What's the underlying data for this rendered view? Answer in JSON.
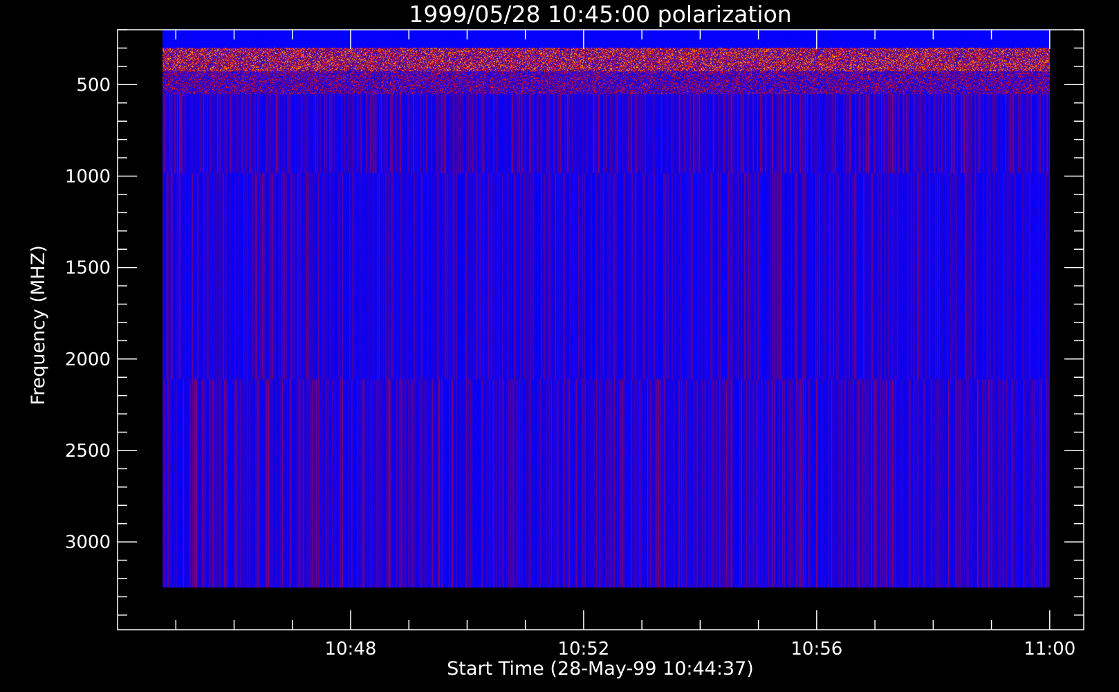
{
  "chart_data": {
    "type": "heatmap",
    "title": "1999/05/28 10:45:00 polarization",
    "xlabel": "Start Time (28-May-99 10:44:37)",
    "ylabel": "Frequency (MHZ)",
    "x_ticks": [
      "10:48",
      "10:52",
      "10:56",
      "11:00"
    ],
    "x_tick_minutes": [
      3.383,
      7.383,
      11.383,
      15.383
    ],
    "x_range_minutes": [
      -0.617,
      15.967
    ],
    "data_x_range_minutes": [
      0.15,
      15.383
    ],
    "y_ticks": [
      500,
      1000,
      1500,
      2000,
      2500,
      3000
    ],
    "y_range": [
      200,
      3480
    ],
    "y_reversed": true,
    "data_y_range": [
      200,
      3250
    ],
    "frequency_bands_mhz": [
      [
        200,
        550
      ],
      [
        550,
        980
      ],
      [
        980,
        2110
      ],
      [
        2110,
        3250
      ]
    ],
    "colormap": [
      "#0000ff",
      "#7a0070",
      "#ff1a00",
      "#ffd200"
    ],
    "grid": false,
    "legend": "none"
  }
}
